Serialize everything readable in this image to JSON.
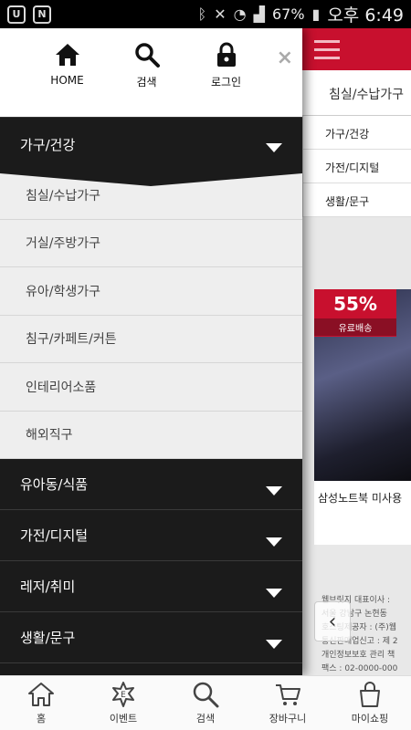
{
  "status_bar": {
    "battery": "67%",
    "time": "오후 6:49",
    "left_icon_1": "U",
    "left_icon_2": "N"
  },
  "background_page": {
    "category_title": "침실/수납가구",
    "list": [
      "가구/건강",
      "가전/디지털",
      "생활/문구"
    ],
    "product": {
      "discount": "55%",
      "shipping": "유료배송",
      "name": "삼성노트북 미사용"
    },
    "footer_lines": [
      "웹브릿지 대표이사 : ",
      "서울 강남구 논현동",
      "호스팅제공자 : (주)웹",
      "통신판매업신고 : 제 2",
      "개인정보보호 관리 책",
      "팩스 : 02-0000-000"
    ]
  },
  "drawer": {
    "top_buttons": [
      {
        "label": "HOME",
        "icon": "home-icon"
      },
      {
        "label": "검색",
        "icon": "search-icon"
      },
      {
        "label": "로그인",
        "icon": "lock-icon"
      }
    ],
    "close": "×",
    "open_category": "가구/건강",
    "subcategories": [
      "침실/수납가구",
      "거실/주방가구",
      "유아/학생가구",
      "침구/카페트/커튼",
      "인테리어소품",
      "해외직구"
    ],
    "categories": [
      "유아동/식품",
      "가전/디지털",
      "레저/취미",
      "생활/문구"
    ]
  },
  "bottom_nav": [
    {
      "label": "홈",
      "icon": "home-icon"
    },
    {
      "label": "이벤트",
      "icon": "event-icon"
    },
    {
      "label": "검색",
      "icon": "search-icon"
    },
    {
      "label": "장바구니",
      "icon": "cart-icon"
    },
    {
      "label": "마이쇼핑",
      "icon": "my-shopping-icon"
    }
  ],
  "colors": {
    "brand_red": "#c8102e",
    "drawer_dark": "#1b1b1b"
  }
}
